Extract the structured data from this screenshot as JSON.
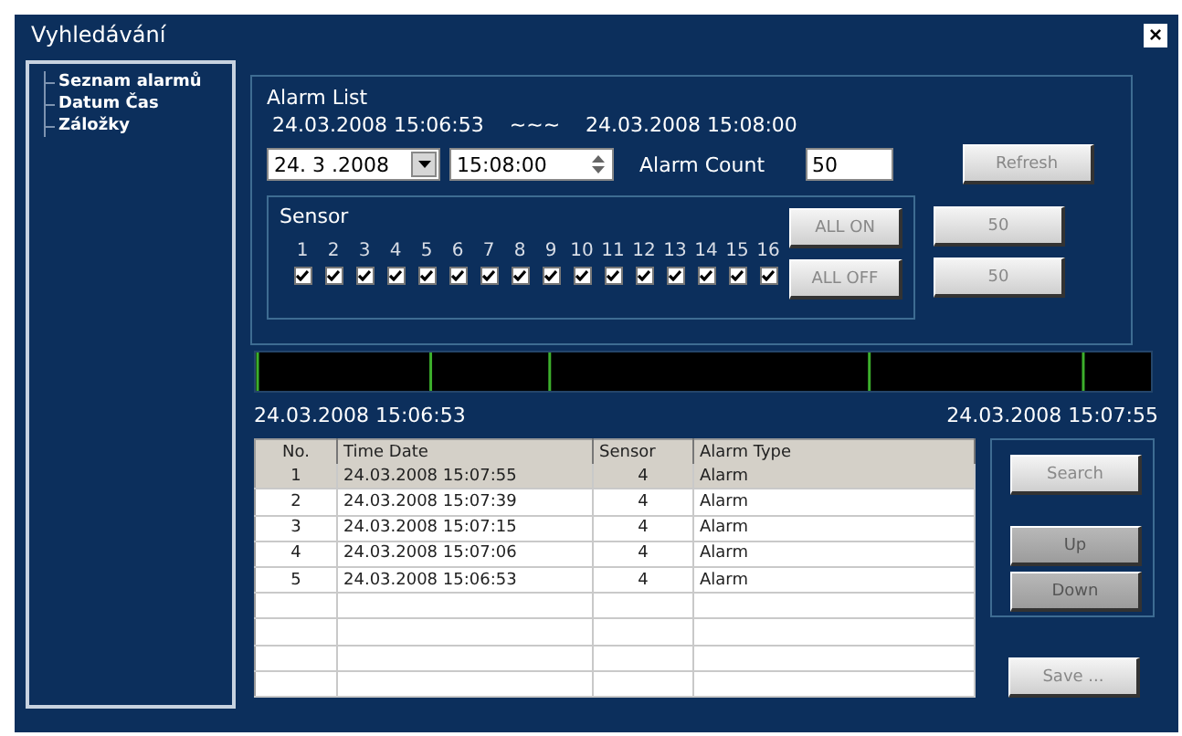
{
  "window": {
    "title": "Vyhledávání",
    "close": "×"
  },
  "sidebar": {
    "items": [
      {
        "label": "Seznam alarmů"
      },
      {
        "label": "Datum Čas"
      },
      {
        "label": "Záložky"
      }
    ]
  },
  "alarm_list": {
    "title": "Alarm List",
    "range_start": "24.03.2008 15:06:53",
    "range_separator": "~~~",
    "range_end": "24.03.2008 15:08:00",
    "date": "24. 3 .2008",
    "time": "15:08:00",
    "alarm_count_label": "Alarm Count",
    "alarm_count": "50",
    "refresh": "Refresh"
  },
  "sensor": {
    "title": "Sensor",
    "all_on": "ALL ON",
    "all_off": "ALL OFF",
    "channels": [
      {
        "label": "1",
        "checked": true
      },
      {
        "label": "2",
        "checked": true
      },
      {
        "label": "3",
        "checked": true
      },
      {
        "label": "4",
        "checked": true
      },
      {
        "label": "5",
        "checked": true
      },
      {
        "label": "6",
        "checked": true
      },
      {
        "label": "7",
        "checked": true
      },
      {
        "label": "8",
        "checked": true
      },
      {
        "label": "9",
        "checked": true
      },
      {
        "label": "10",
        "checked": true
      },
      {
        "label": "11",
        "checked": true
      },
      {
        "label": "12",
        "checked": true
      },
      {
        "label": "13",
        "checked": true
      },
      {
        "label": "14",
        "checked": true
      },
      {
        "label": "15",
        "checked": true
      },
      {
        "label": "16",
        "checked": true
      }
    ]
  },
  "side_buttons": [
    "50",
    "50"
  ],
  "timeline": {
    "start": "24.03.2008 15:06:53",
    "end": "24.03.2008 15:07:55"
  },
  "table": {
    "columns": [
      "No.",
      "Time Date",
      "Sensor",
      "Alarm Type"
    ],
    "rows": [
      {
        "cells": [
          "1",
          "24.03.2008 15:07:55",
          "4",
          "Alarm"
        ],
        "selected": true
      },
      {
        "cells": [
          "2",
          "24.03.2008 15:07:39",
          "4",
          "Alarm"
        ],
        "selected": false
      },
      {
        "cells": [
          "3",
          "24.03.2008 15:07:15",
          "4",
          "Alarm"
        ],
        "selected": false
      },
      {
        "cells": [
          "4",
          "24.03.2008 15:07:06",
          "4",
          "Alarm"
        ],
        "selected": false
      },
      {
        "cells": [
          "5",
          "24.03.2008 15:06:53",
          "4",
          "Alarm"
        ],
        "selected": false
      }
    ]
  },
  "buttons": [
    {
      "label": "Search",
      "disabled": false
    },
    {
      "label": "Up",
      "disabled": true
    },
    {
      "label": "Down",
      "disabled": true
    }
  ],
  "save": "Save ..."
}
